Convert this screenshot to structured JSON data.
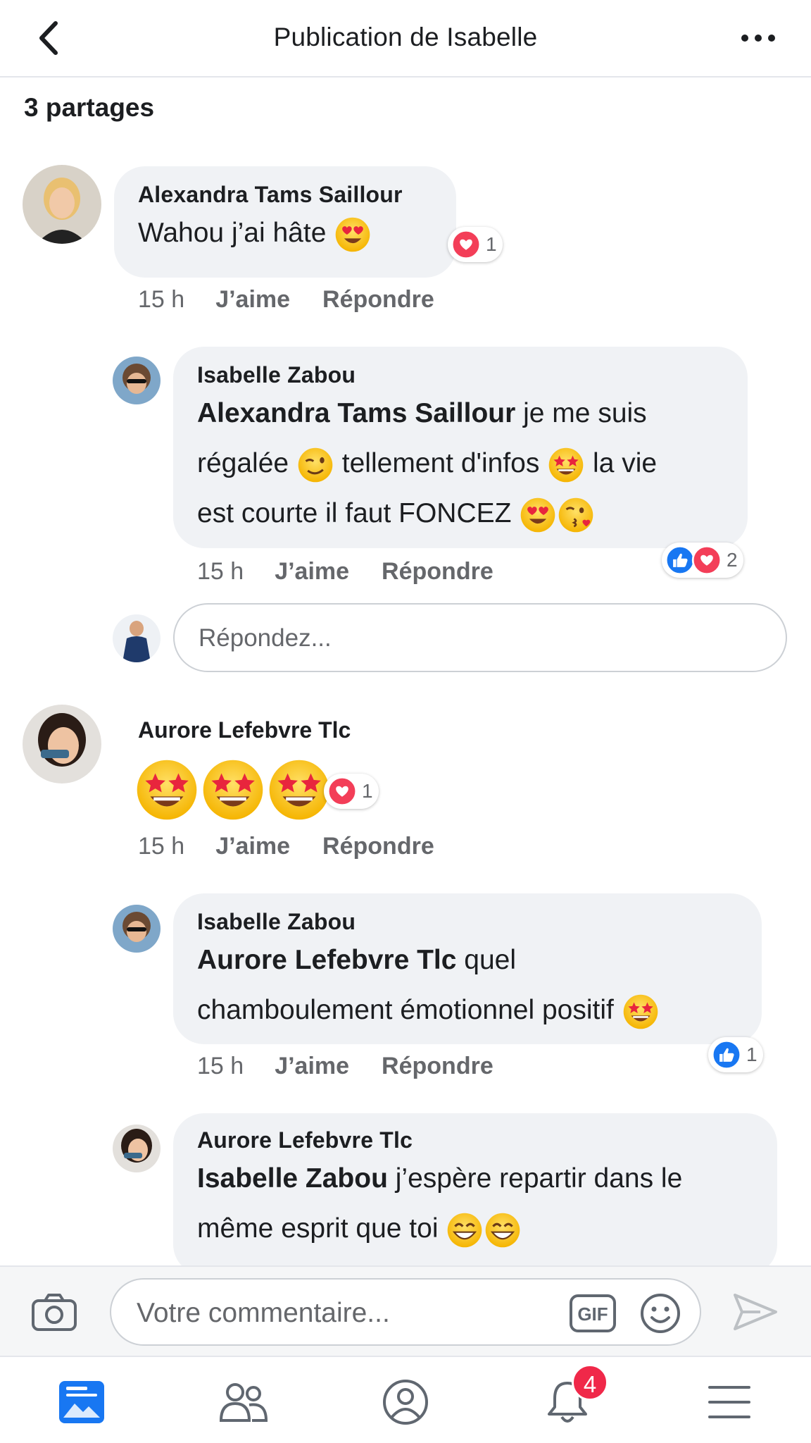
{
  "header": {
    "title": "Publication de Isabelle",
    "back_icon": "chevron-left-icon",
    "more_icon": "ellipsis-icon"
  },
  "shares_label": "3 partages",
  "actions": {
    "like": "J’aime",
    "reply": "Répondre"
  },
  "comments": [
    {
      "author": "Alexandra Tams Saillour",
      "text": "Wahou j’ai hâte",
      "time": "15 h",
      "reaction_count": "1"
    },
    {
      "author": "Isabelle Zabou",
      "mention": "Alexandra Tams Saillour",
      "text_1": " je me suis",
      "text_2": "régalée ",
      "text_3": " tellement d'infos ",
      "text_4": " la vie",
      "text_5": "est courte il faut FONCEZ ",
      "time": "15 h",
      "reaction_count": "2"
    },
    {
      "author": "Aurore Lefebvre Tlc",
      "time": "15 h",
      "reaction_count": "1"
    },
    {
      "author": "Isabelle Zabou",
      "mention": "Aurore Lefebvre Tlc",
      "text_1": " quel",
      "text_2": "chamboulement émotionnel positif ",
      "time": "15 h",
      "reaction_count": "1"
    },
    {
      "author": "Aurore Lefebvre Tlc",
      "mention": "Isabelle Zabou",
      "text_1": " j’espère repartir dans le",
      "text_2": "même esprit que toi "
    }
  ],
  "reply_placeholder": "Répondez...",
  "composer": {
    "placeholder": "Votre commentaire...",
    "gif_label": "GIF"
  },
  "tabbar": {
    "notification_badge": "4",
    "icons": [
      "news-feed-icon",
      "friends-icon",
      "profile-icon",
      "notifications-bell-icon",
      "menu-icon"
    ]
  },
  "colors": {
    "facebook_blue": "#1877f2",
    "love_red": "#f33e58",
    "bubble_gray": "#f0f2f5",
    "meta_gray": "#65676b",
    "badge_red": "#f02849"
  }
}
